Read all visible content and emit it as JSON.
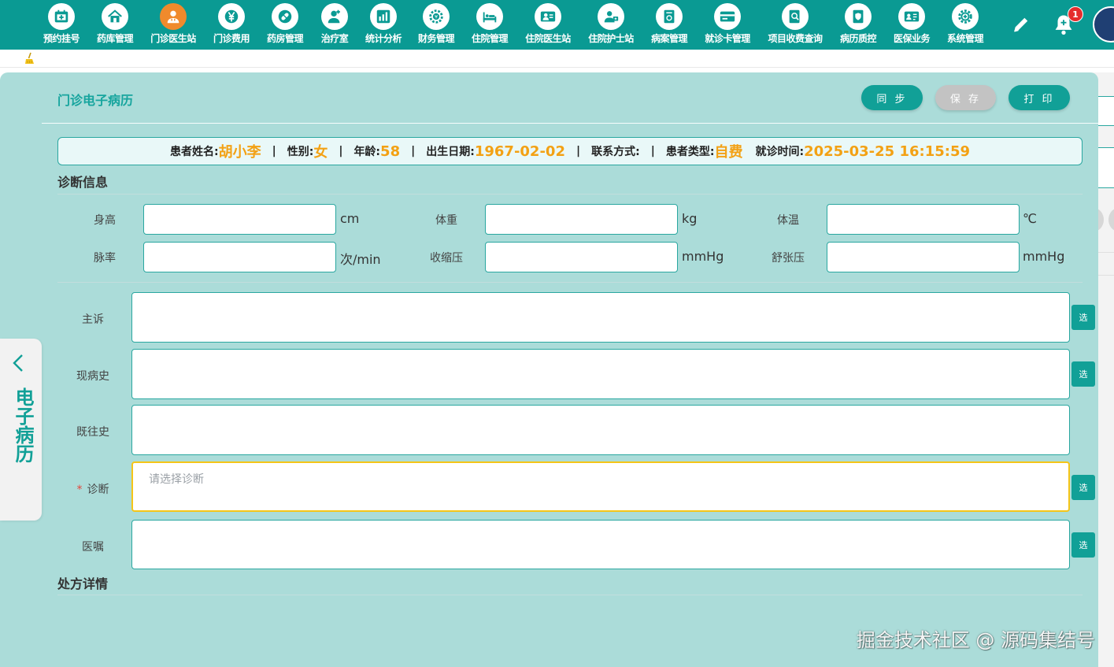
{
  "nav": {
    "items": [
      {
        "label": "预约挂号",
        "icon": "calendar-icon"
      },
      {
        "label": "药库管理",
        "icon": "pharmacy-house-icon"
      },
      {
        "label": "门诊医生站",
        "icon": "doctor-icon"
      },
      {
        "label": "门诊费用",
        "icon": "yen-icon"
      },
      {
        "label": "药房管理",
        "icon": "pill-icon"
      },
      {
        "label": "治疗室",
        "icon": "nurse-icon"
      },
      {
        "label": "统计分析",
        "icon": "bar-chart-icon"
      },
      {
        "label": "财务管理",
        "icon": "gear-money-icon"
      },
      {
        "label": "住院管理",
        "icon": "hospital-bed-icon"
      },
      {
        "label": "住院医生站",
        "icon": "doctor-card-icon"
      },
      {
        "label": "住院护士站",
        "icon": "nurse-card-icon"
      },
      {
        "label": "病案管理",
        "icon": "record-folder-icon"
      },
      {
        "label": "就诊卡管理",
        "icon": "card-icon"
      },
      {
        "label": "项目收费查询",
        "icon": "search-document-icon"
      },
      {
        "label": "病历质控",
        "icon": "shield-document-icon"
      },
      {
        "label": "医保业务",
        "icon": "insurance-card-icon"
      },
      {
        "label": "系统管理",
        "icon": "settings-icon"
      }
    ],
    "active_index": 2,
    "notification_count": "1",
    "colors": {
      "bar": "#0a9a93",
      "active": "#f08a2c"
    }
  },
  "panel": {
    "title": "门诊电子病历",
    "buttons": {
      "sync": "同 步",
      "save": "保 存",
      "print": "打 印"
    }
  },
  "patient": {
    "name_label": "患者姓名:",
    "name": "胡小李",
    "sex_label": "性别:",
    "sex": "女",
    "age_label": "年龄:",
    "age": "58",
    "dob_label": "出生日期:",
    "dob": "1967-02-02",
    "contact_label": "联系方式:",
    "contact": "",
    "type_label": "患者类型:",
    "type": "自费",
    "visit_label": "就诊时间:",
    "visit_time": "2025-03-25 16:15:59",
    "separator": "|"
  },
  "diagnosis": {
    "section_title": "诊断信息",
    "vitals": [
      {
        "label": "身高",
        "unit": "cm",
        "value": ""
      },
      {
        "label": "体重",
        "unit": "kg",
        "value": ""
      },
      {
        "label": "体温",
        "unit": "℃",
        "value": ""
      },
      {
        "label": "脉率",
        "unit": "次/min",
        "value": ""
      },
      {
        "label": "收缩压",
        "unit": "mmHg",
        "value": ""
      },
      {
        "label": "舒张压",
        "unit": "mmHg",
        "value": ""
      }
    ],
    "fields": [
      {
        "label": "主诉",
        "value": "",
        "placeholder": "",
        "select": "选"
      },
      {
        "label": "现病史",
        "value": "",
        "placeholder": "",
        "select": "选"
      },
      {
        "label": "既往史",
        "value": "",
        "placeholder": ""
      },
      {
        "label": "诊断",
        "required_mark": "*",
        "value": "",
        "placeholder": "请选择诊断",
        "select": "选"
      },
      {
        "label": "医嘱",
        "value": "",
        "placeholder": "",
        "select": "选"
      }
    ]
  },
  "prescription": {
    "section_title": "处方详情"
  },
  "side_tab": {
    "label": "电子病历"
  },
  "watermark": "掘金技术社区 @ 源码集结号"
}
